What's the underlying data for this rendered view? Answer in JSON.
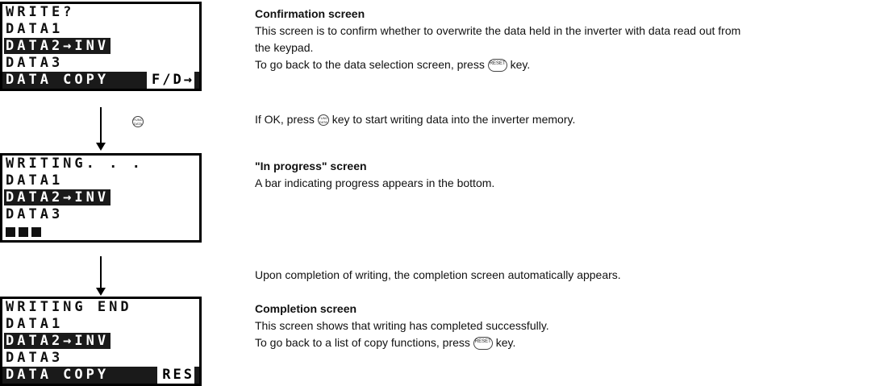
{
  "screen1": {
    "row1": "WRITE?",
    "row2": "DATA1",
    "row3": "DATA2→INV",
    "row4": "DATA3",
    "row5": "DATA COPY",
    "row5_sub": "F/D→"
  },
  "screen2": {
    "row1": "WRITING. . .",
    "row2": "DATA1",
    "row3": "DATA2→INV",
    "row4": "DATA3",
    "progress_blocks": 3
  },
  "screen3": {
    "row1": "WRITING END",
    "row2": "DATA1",
    "row3": "DATA2→INV",
    "row4": "DATA3",
    "row5": "DATA COPY",
    "row5_sub": "RES"
  },
  "keys": {
    "func_data": "FUNC DATA",
    "reset": "RESET"
  },
  "text": {
    "confirm_heading": "Confirmation screen",
    "confirm_line1": "This screen is to confirm whether to overwrite the data held in the inverter with data read out from",
    "confirm_line2": "the keypad.",
    "confirm_line3_a": "To go back to the data selection screen, press",
    "confirm_line3_b": "key.",
    "ok_a": "If OK, press",
    "ok_b": "key to start writing data into the inverter memory.",
    "progress_heading": "\"In progress\" screen",
    "progress_line": "A bar indicating progress appears in the bottom.",
    "completion_auto": "Upon completion of writing, the completion screen automatically appears.",
    "complete_heading": "Completion screen",
    "complete_line1": "This screen shows that writing has completed successfully.",
    "complete_line2_a": "To go back to a list of copy functions, press",
    "complete_line2_b": "key."
  }
}
